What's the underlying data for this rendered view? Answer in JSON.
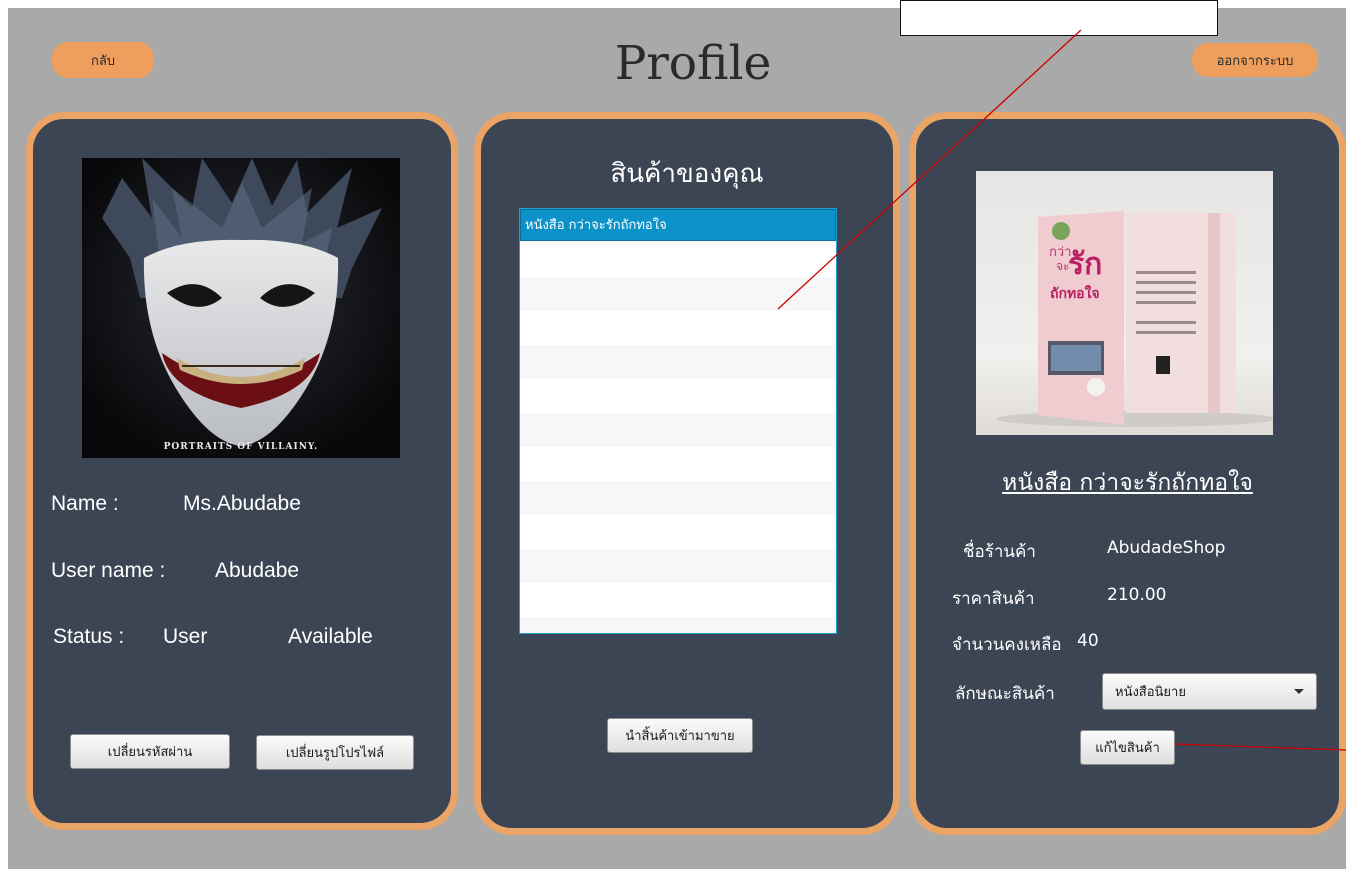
{
  "header": {
    "back_label": "กลับ",
    "title": "Profile",
    "logout_label": "ออกจากระบบ",
    "annotation_box_text": ""
  },
  "profile": {
    "avatar_caption": "PORTRAITS OF VILLAINY.",
    "name_label": "Name :",
    "name_value": "Ms.Abudabe",
    "username_label": "User name :",
    "username_value": "Abudabe",
    "status_label": "Status :",
    "status_role": "User",
    "status_value": "Available",
    "change_password_label": "เปลี่ยนรหัสผ่าน",
    "change_photo_label": "เปลี่ยนรูปโปรไฟล์"
  },
  "products": {
    "heading": "สินค้าของคุณ",
    "items": [
      "หนังสือ กว่าจะรักถักทอใจ"
    ],
    "add_button_label": "นำสิ้นค้าเข้ามาขาย"
  },
  "detail": {
    "product_title": "หนังสือ กว่าจะรักถักทอใจ",
    "shop_label": "ชื่อร้านค้า",
    "shop_value": "AbudadeShop",
    "price_label": "ราคาสินค้า",
    "price_value": "210.00",
    "stock_label": "จำนวนคงเหลือ",
    "stock_value": "40",
    "category_label": "ลักษณะสินค้า",
    "category_value": "หนังสือนิยาย",
    "edit_button_label": "แก้ไขสินค้า",
    "cover_text_1": "กว่า",
    "cover_text_2": "จะ",
    "cover_text_3": "รัก",
    "cover_text_4": "ถักทอใจ"
  },
  "colors": {
    "background": "#a9a9a9",
    "panel": "#3c4554",
    "panel_border": "#eaa466",
    "accent_button": "#ee9f5e",
    "selection": "#0b92c9",
    "annotation_line": "#cc0000"
  }
}
